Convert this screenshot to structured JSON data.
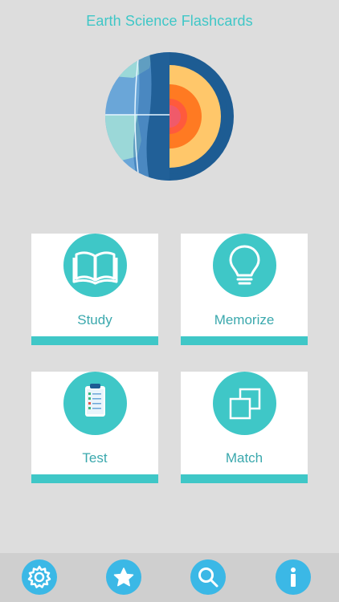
{
  "header": {
    "title": "Earth Science Flashcards"
  },
  "logo": {
    "icon": "earth-layers-icon"
  },
  "menu": {
    "study_label": "Study",
    "memorize_label": "Memorize",
    "test_label": "Test",
    "match_label": "Match"
  },
  "tabbar": {
    "items": [
      {
        "icon": "gear-icon"
      },
      {
        "icon": "star-icon"
      },
      {
        "icon": "search-icon"
      },
      {
        "icon": "info-icon"
      }
    ]
  },
  "colors": {
    "background": "#dddddd",
    "accent": "#3fc7c7",
    "label": "#3aa8ad",
    "tab_icon": "#3bb8e6",
    "tabbar_bg": "#cfcfcf"
  }
}
